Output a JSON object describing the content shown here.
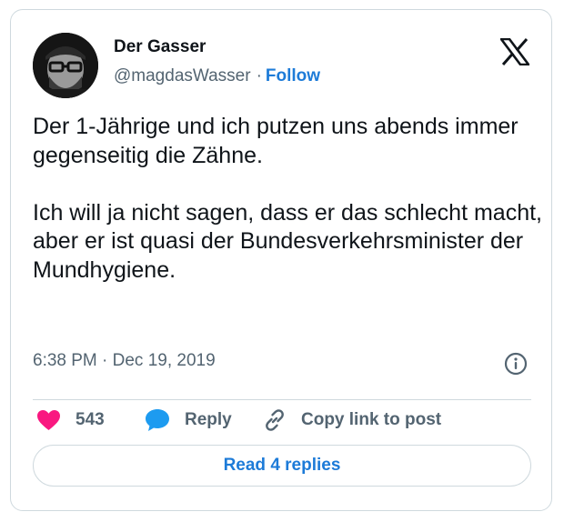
{
  "author": {
    "name": "Der Gasser",
    "handle": "@magdasWasser",
    "separator": "·",
    "follow_label": "Follow"
  },
  "tweet": {
    "paragraphs": [
      "Der 1-Jährige und ich putzen uns abends immer gegenseitig die Zähne.",
      "Ich will ja nicht sagen, dass er das schlecht macht, aber er ist quasi der Bundesverkehrsminister der Mundhygiene."
    ],
    "timestamp": "6:38 PM · Dec 19, 2019"
  },
  "actions": {
    "like_count": "543",
    "reply_label": "Reply",
    "copy_link_label": "Copy link to post"
  },
  "read_replies_label": "Read 4 replies",
  "icons": {
    "logo": "x-logo-icon",
    "info": "info-icon",
    "like": "heart-icon",
    "reply": "speech-bubble-icon",
    "copy": "link-icon"
  },
  "colors": {
    "accent": "#1d7bd8",
    "like": "#f91880",
    "secondary_text": "#536471",
    "border": "#cfd9de"
  }
}
